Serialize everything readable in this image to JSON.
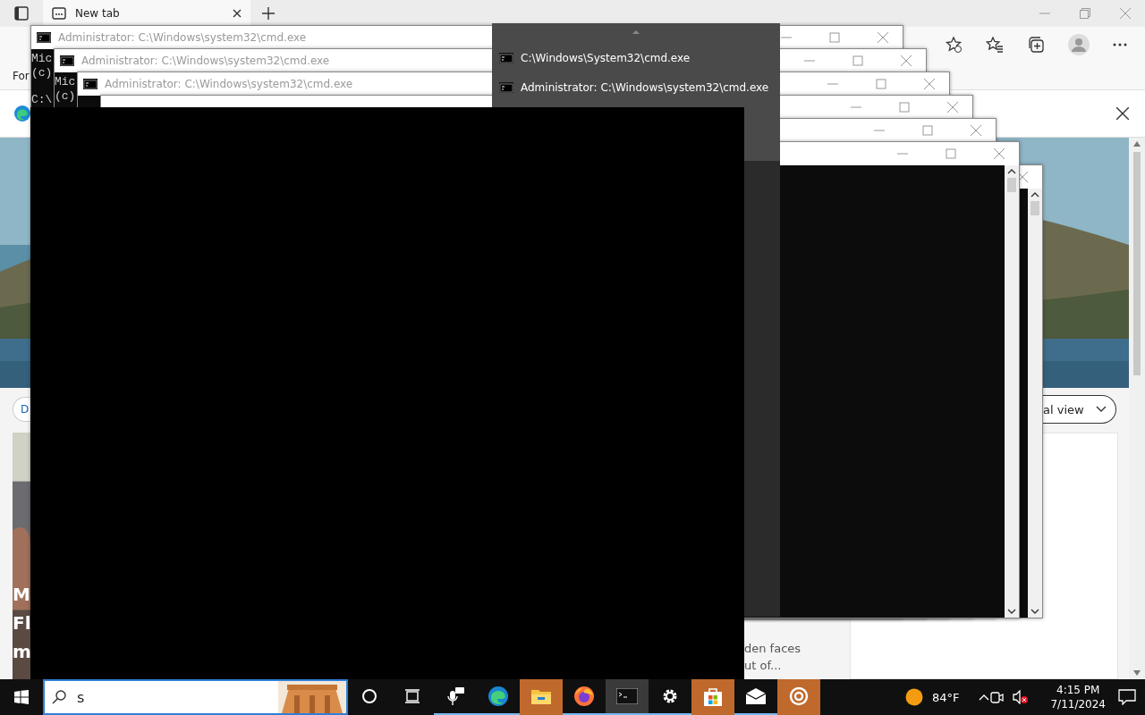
{
  "browser": {
    "tab": {
      "title": "New tab",
      "selected": true
    },
    "toolbar_text": "For",
    "chip_text": "D",
    "view_button": "al view",
    "card_texts": [
      "M",
      "Fl",
      "m"
    ],
    "story_texts": [
      "den faces",
      "ut of..."
    ]
  },
  "cmd_windows": [
    {
      "kind": "console",
      "title": "Administrator: C:\\Windows\\system32\\cmd.exe",
      "console": [
        "Mic",
        "(c)"
      ],
      "prompt": "C:\\"
    },
    {
      "kind": "console",
      "title": "Administrator: C:\\Windows\\system32\\cmd.exe",
      "console": [
        "Mic",
        "(c)"
      ]
    },
    {
      "kind": "console",
      "title": "Administrator: C:\\Windows\\system32\\cmd.exe"
    },
    {
      "kind": "console"
    },
    {
      "kind": "console"
    },
    {
      "kind": "console",
      "scrollbar": true
    },
    {
      "kind": "console",
      "scrollbar": true,
      "behind_previous": true
    }
  ],
  "preview": {
    "items": [
      "C:\\Windows\\System32\\cmd.exe",
      "Administrator: C:\\Windows\\system32\\cmd.exe"
    ]
  },
  "taskbar": {
    "search": {
      "value": "s"
    },
    "apps": [
      {
        "kind": "cortana",
        "running": false,
        "focused": false,
        "attention": false
      },
      {
        "kind": "task-view",
        "running": false,
        "focused": false,
        "attention": false
      },
      {
        "kind": "chat",
        "running": true,
        "focused": false,
        "attention": false
      },
      {
        "kind": "edge",
        "running": true,
        "focused": false,
        "attention": false
      },
      {
        "kind": "explorer",
        "running": false,
        "focused": false,
        "attention": true
      },
      {
        "kind": "firefox",
        "running": true,
        "focused": false,
        "attention": false
      },
      {
        "kind": "cmd",
        "running": true,
        "focused": true,
        "attention": false
      },
      {
        "kind": "settings",
        "running": true,
        "focused": false,
        "attention": false
      },
      {
        "kind": "store",
        "running": false,
        "focused": false,
        "attention": true
      },
      {
        "kind": "mail",
        "running": true,
        "focused": false,
        "attention": false
      },
      {
        "kind": "target",
        "running": false,
        "focused": false,
        "attention": true
      }
    ],
    "weather": "84°F",
    "time": "4:15 PM",
    "date": "7/11/2024"
  }
}
